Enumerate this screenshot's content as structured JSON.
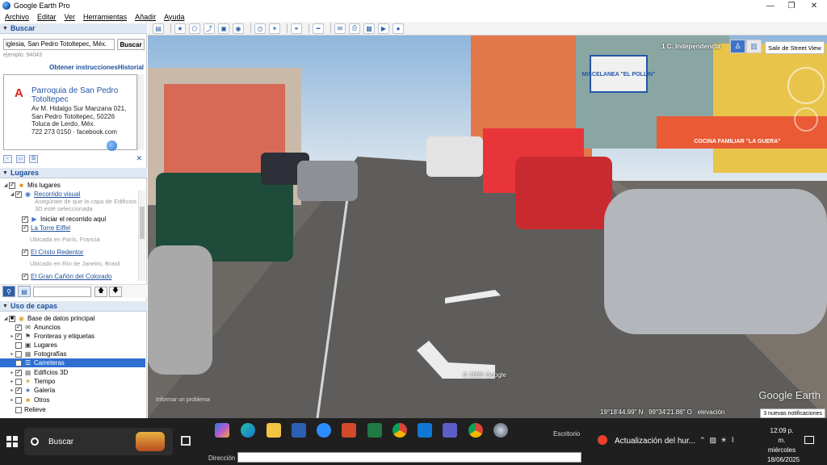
{
  "window": {
    "title": "Google Earth Pro"
  },
  "menu": [
    "Archivo",
    "Editar",
    "Ver",
    "Herramientas",
    "Añadir",
    "Ayuda"
  ],
  "search": {
    "header": "Buscar",
    "query": "iglesia, San Pedro Totoltepec, Méx.",
    "button": "Buscar",
    "example": "ejemplo: 94043",
    "get_directions": "Obtener instrucciones",
    "history": "Historial",
    "result": {
      "marker": "A",
      "name": "Parroquia de San Pedro Totoltepec",
      "address": "Av M. Hidalgo Sur Manzana 021, San Pedro Totoltepec, 50226 Toluca de Lerdo, Méx.",
      "phone": "722 273 0150 · facebook.com"
    }
  },
  "places": {
    "header": "Lugares",
    "items": [
      {
        "label": "Mis lugares",
        "link": false
      },
      {
        "label": "Recorrido visual",
        "link": true,
        "sub": "Asegúrate de que la capa de Edificios 3D esté seleccionada"
      },
      {
        "label": "Iniciar el recorrido aquí",
        "link": false
      },
      {
        "label": "La Torre Eiffel",
        "link": true,
        "sub": "Ubicada en París, Francia"
      },
      {
        "label": "El Cristo Redentor",
        "link": true,
        "sub": "Ubicado en Río de Janeiro, Brasil"
      },
      {
        "label": "El Gran Cañón del Colorado",
        "link": true
      }
    ]
  },
  "layers": {
    "header": "Uso de capas",
    "items": [
      {
        "label": "Base de datos principal",
        "selected": false
      },
      {
        "label": "Anuncios",
        "selected": false
      },
      {
        "label": "Fronteras y etiquetas",
        "selected": false
      },
      {
        "label": "Lugares",
        "selected": false
      },
      {
        "label": "Fotografías",
        "selected": false
      },
      {
        "label": "Carreteras",
        "selected": true
      },
      {
        "label": "Edificios 3D",
        "selected": false
      },
      {
        "label": "Tiempo",
        "selected": false
      },
      {
        "label": "Galería",
        "selected": false
      },
      {
        "label": "Otros",
        "selected": false
      },
      {
        "label": "Relieve",
        "selected": false
      }
    ]
  },
  "view": {
    "address": "1 C. Independencia",
    "exit_street_view": "Salir de Street View",
    "watermark": "Google Earth",
    "copyright": "© 2025 Google",
    "report": "Informar un problema",
    "lat": "19°18'44.99\" N",
    "lon": "99°34'21.88\" O",
    "elevation_label": "elevación",
    "notifications": "3 nuevas notificaciones",
    "signs": {
      "misc": "MISCELANEA \"EL POLLIN\"",
      "cocina": "COCINA FAMILIAR  \"LA GUERA\""
    }
  },
  "taskbar": {
    "search": "Buscar",
    "desktop": "Escritorio",
    "news": "Actualización del hur...",
    "time": "12:09 p. m.",
    "day": "miércoles",
    "date": "18/06/2025",
    "address_label": "Dirección"
  },
  "colors": {
    "accent": "#1c4f9a",
    "selection": "#2f6fd1",
    "taskbar": "#1f1f1f"
  }
}
